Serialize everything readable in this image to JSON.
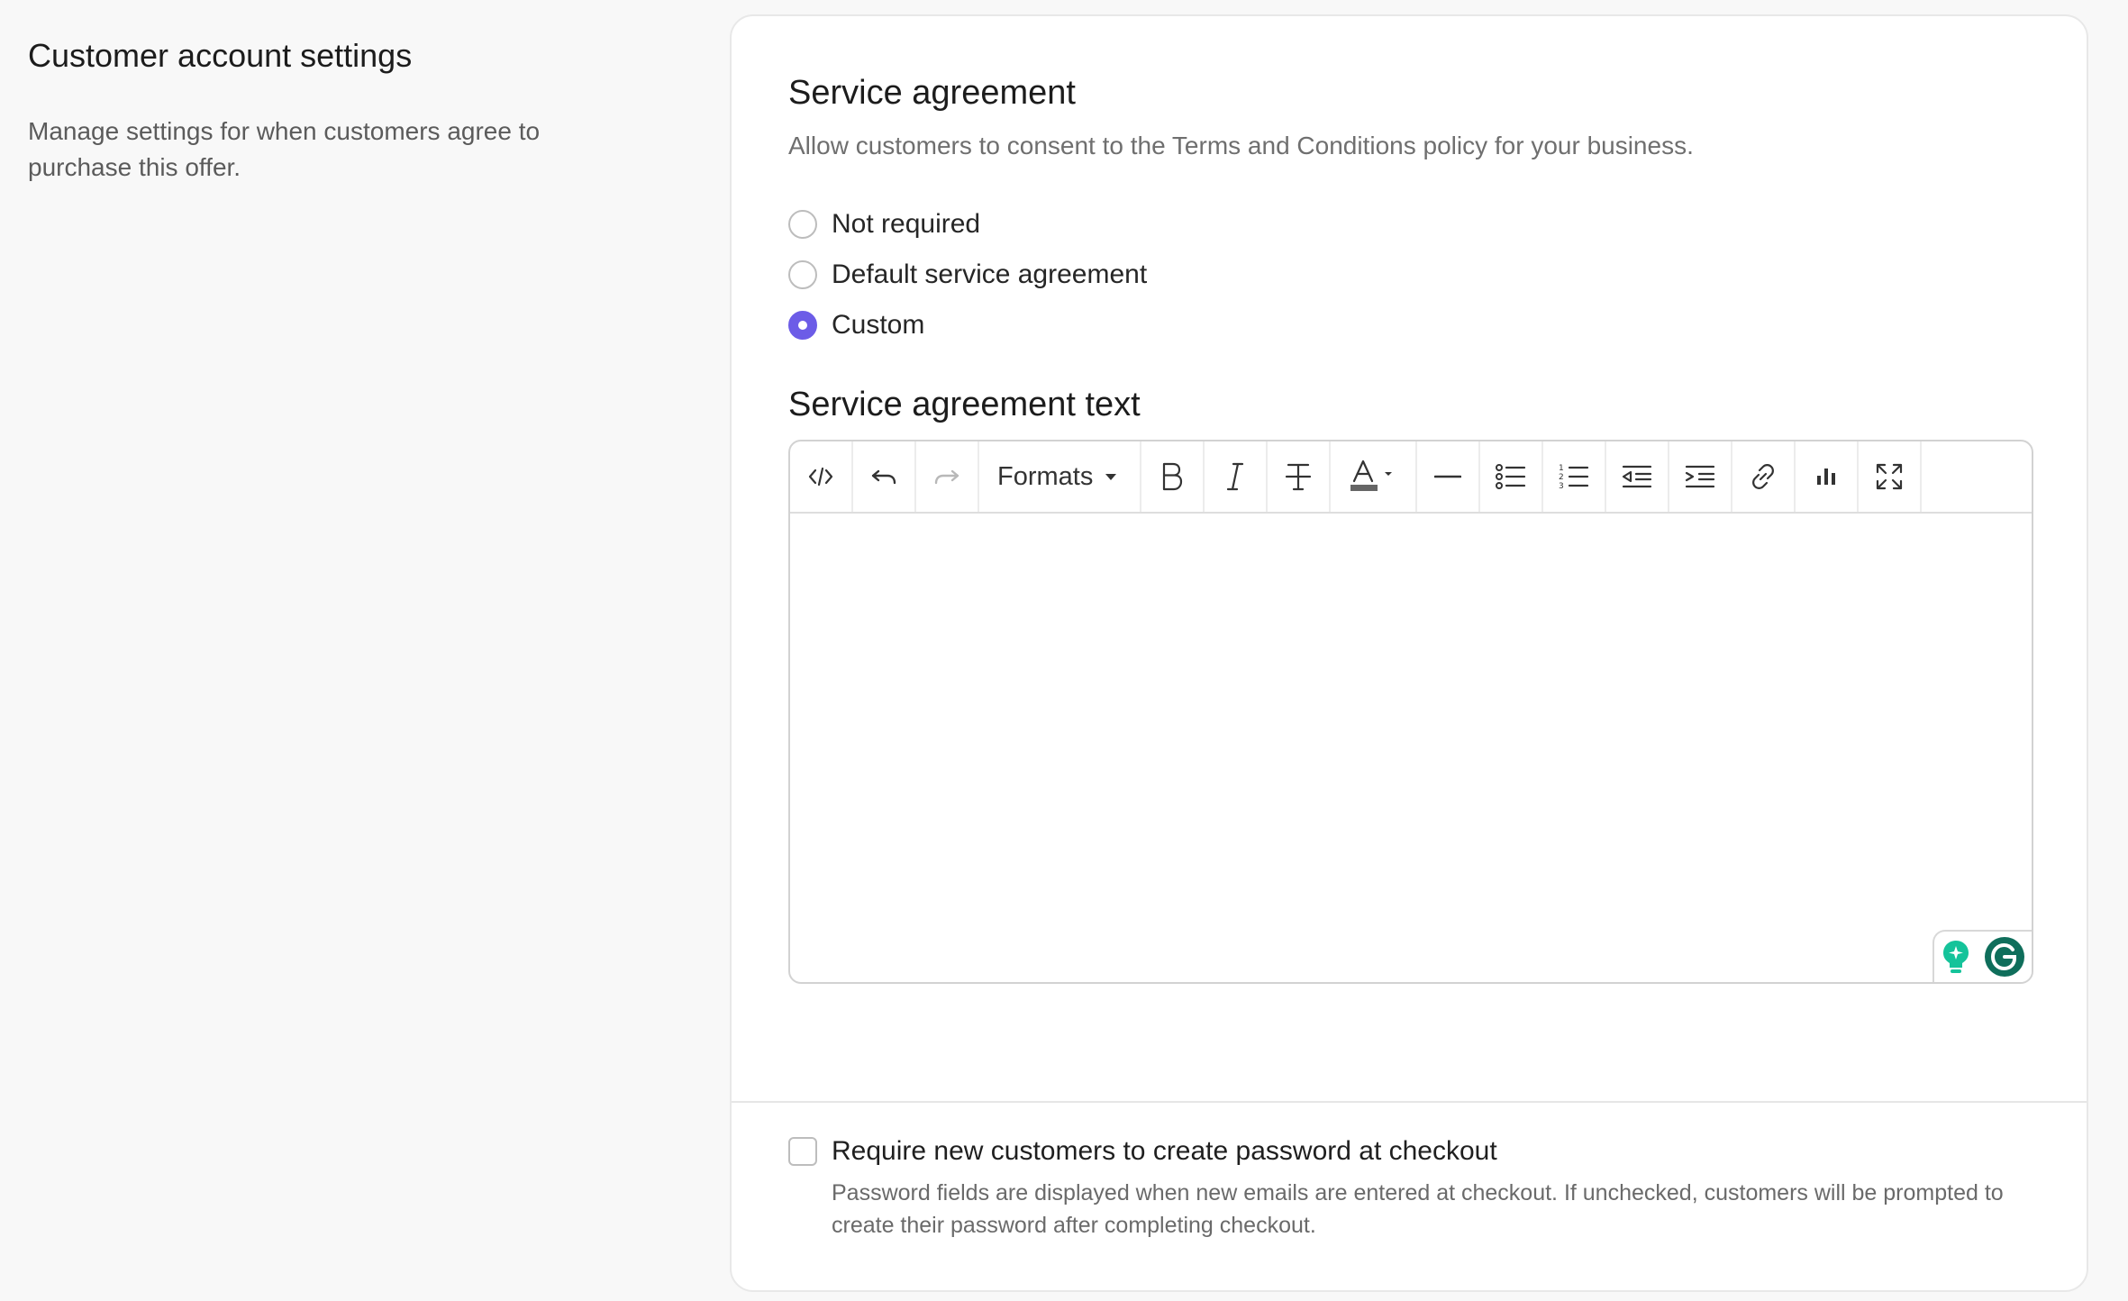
{
  "left": {
    "title": "Customer account settings",
    "description": "Manage settings for when customers agree to purchase this offer."
  },
  "service_agreement": {
    "title": "Service agreement",
    "description": "Allow customers to consent to the Terms and Conditions policy for your business.",
    "options": [
      {
        "label": "Not required",
        "checked": false
      },
      {
        "label": "Default service agreement",
        "checked": false
      },
      {
        "label": "Custom",
        "checked": true
      }
    ]
  },
  "editor": {
    "title": "Service agreement text",
    "formats_label": "Formats",
    "toolbar_icons": [
      "code-icon",
      "undo-icon",
      "redo-icon",
      "formats-dropdown",
      "bold-icon",
      "italic-icon",
      "strikethrough-icon",
      "text-color-icon",
      "horizontal-rule-icon",
      "bullet-list-icon",
      "numbered-list-icon",
      "outdent-icon",
      "indent-icon",
      "link-icon",
      "chart-icon",
      "fullscreen-icon"
    ],
    "content": ""
  },
  "password": {
    "label": "Require new customers to create password at checkout",
    "help": "Password fields are displayed when new emails are entered at checkout. If unchecked, customers will be prompted to create their password after completing checkout.",
    "checked": false
  },
  "colors": {
    "accent": "#6c5ce7",
    "grammarly": "#15c39a",
    "grammarly_dark": "#0f6e5b"
  }
}
